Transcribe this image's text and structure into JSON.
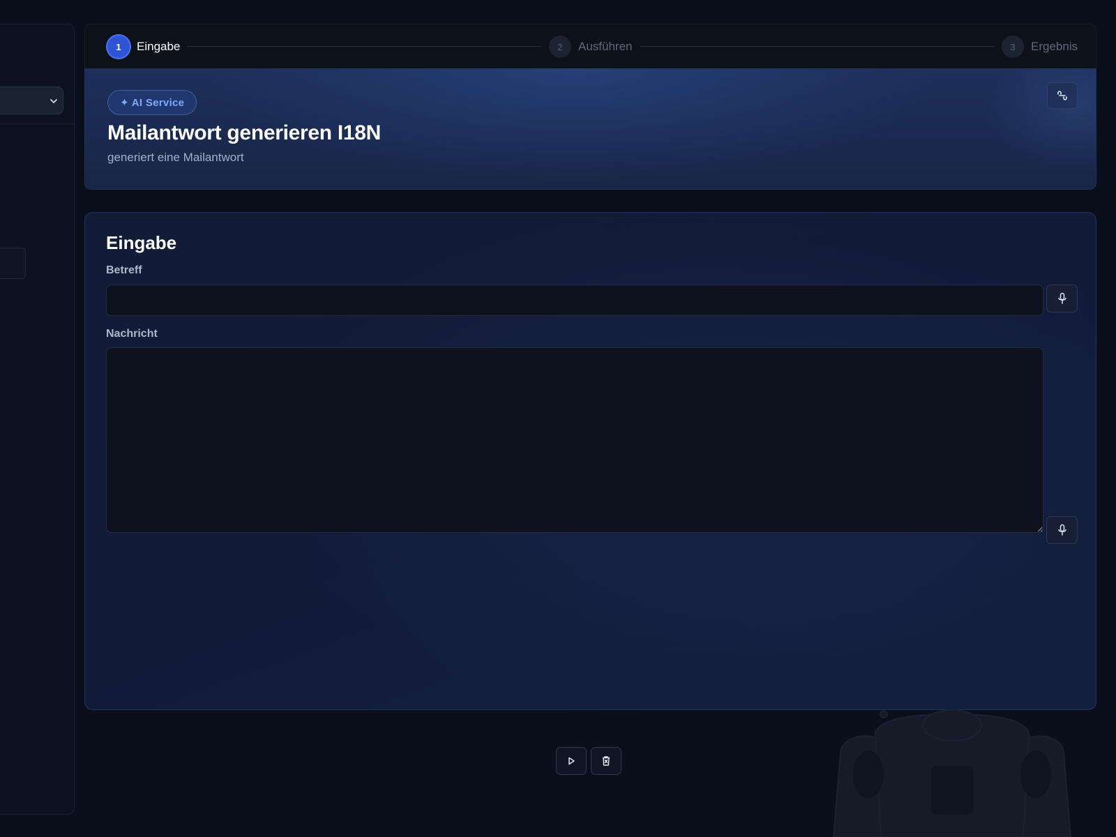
{
  "stepper": {
    "steps": [
      {
        "number": "1",
        "label": "Eingabe",
        "state": "active"
      },
      {
        "number": "2",
        "label": "Ausführen",
        "state": "inactive"
      },
      {
        "number": "3",
        "label": "Ergebnis",
        "state": "inactive"
      }
    ]
  },
  "header": {
    "badge_icon": "sparkle-icon",
    "badge_label": "✦ AI Service",
    "title": "Mailantwort generieren I18N",
    "subtitle": "generiert eine Mailantwort",
    "corner_icon": "link-icon"
  },
  "form": {
    "heading": "Eingabe",
    "fields": [
      {
        "label": "Betreff",
        "value": "",
        "type": "text",
        "icon": "microphone-icon"
      },
      {
        "label": "Nachricht",
        "value": "",
        "type": "textarea",
        "icon": "microphone-icon"
      }
    ]
  },
  "actions": {
    "run_icon": "play-icon",
    "clear_icon": "trash-icon"
  },
  "sidebar": {
    "select_icon": "chevron-down-icon"
  },
  "colors": {
    "background": "#0b0f1c",
    "accent": "#2f55d4",
    "badge_text": "#7fa8ff",
    "banner": "#1d2f5a",
    "card": "#131c36"
  }
}
